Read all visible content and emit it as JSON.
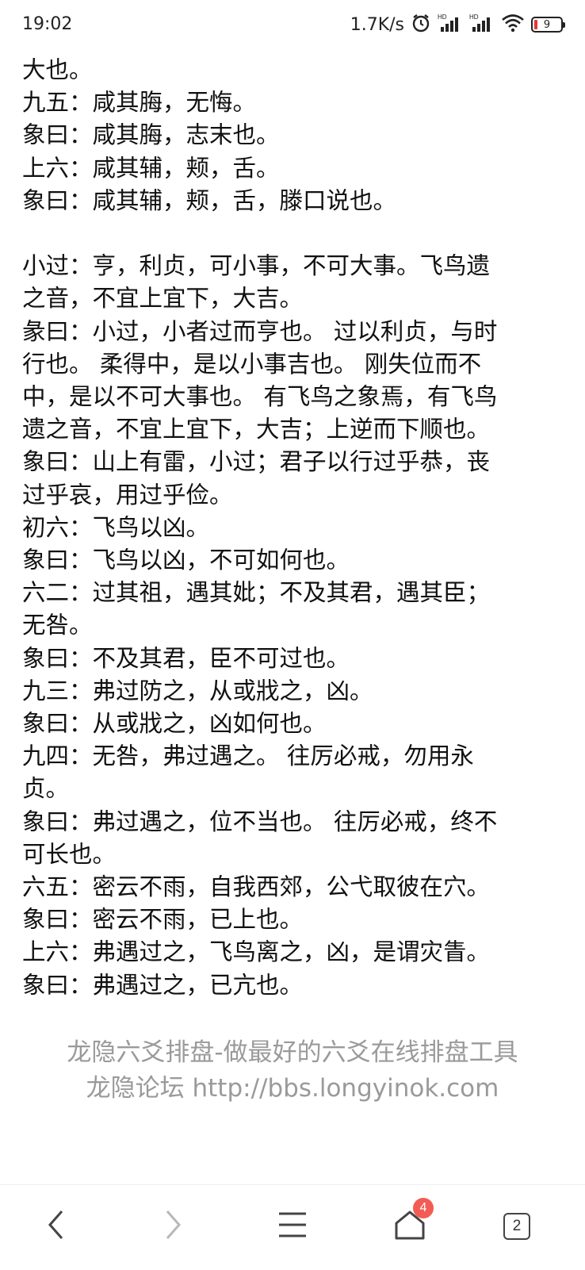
{
  "status_bar": {
    "time": "19:02",
    "net_speed": "1.7K/s",
    "battery_level": "9",
    "icons": [
      "alarm-icon",
      "hd-signal-icon",
      "hd-signal-icon",
      "wifi-icon",
      "battery-icon"
    ]
  },
  "article": {
    "lines": [
      "大也。",
      "九五：咸其脢，无悔。",
      "象曰：咸其脢，志末也。",
      "上六：咸其辅，颊，舌。",
      "象曰：咸其辅，颊，舌，滕口说也。",
      "",
      "小过：亨，利贞，可小事，不可大事。飞鸟遗",
      "之音，不宜上宜下，大吉。",
      "彖曰：小过，小者过而亨也。 过以利贞，与时",
      "行也。 柔得中，是以小事吉也。 刚失位而不",
      "中，是以不可大事也。 有飞鸟之象焉，有飞鸟",
      "遗之音，不宜上宜下，大吉；上逆而下顺也。",
      "象曰：山上有雷，小过；君子以行过乎恭，丧",
      "过乎哀，用过乎俭。",
      "初六：飞鸟以凶。",
      "象曰：飞鸟以凶，不可如何也。",
      "六二：过其祖，遇其妣；不及其君，遇其臣；",
      "无咎。",
      "象曰：不及其君，臣不可过也。",
      "九三：弗过防之，从或戕之，凶。",
      "象曰：从或戕之，凶如何也。",
      "九四：无咎，弗过遇之。 往厉必戒，勿用永",
      "贞。",
      "象曰：弗过遇之，位不当也。 往厉必戒，终不",
      "可长也。",
      "六五：密云不雨，自我西郊，公弋取彼在穴。",
      "象曰：密云不雨，已上也。",
      "上六：弗遇过之，飞鸟离之，凶，是谓灾眚。",
      "象曰：弗遇过之，已亢也。"
    ]
  },
  "footer": {
    "line1": "龙隐六爻排盘-做最好的六爻在线排盘工具",
    "line2": "龙隐论坛 http://bbs.longyinok.com"
  },
  "nav": {
    "home_badge": "4",
    "tab_count": "2",
    "icons": [
      "back-icon",
      "forward-icon",
      "menu-icon",
      "home-icon",
      "tabs-icon"
    ]
  }
}
